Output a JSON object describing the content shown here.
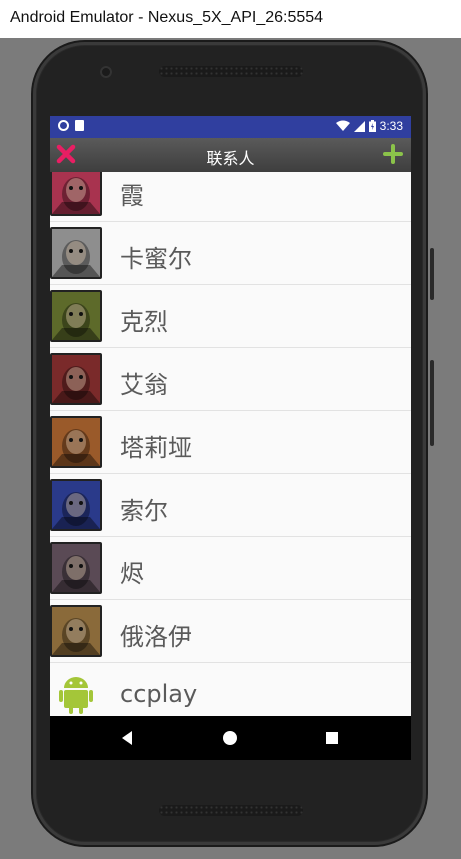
{
  "window": {
    "title": "Android Emulator - Nexus_5X_API_26:5554"
  },
  "statusbar": {
    "time": "3:33",
    "icons": [
      "sync-circle-icon",
      "sd-card-icon",
      "wifi-icon",
      "signal-icon",
      "battery-icon"
    ]
  },
  "toolbar": {
    "title": "联系人",
    "close_icon": "close-x-icon",
    "add_icon": "plus-icon"
  },
  "contacts": [
    {
      "name": "霞",
      "avatar": "champion-portrait-icon",
      "tone": "#a8334f"
    },
    {
      "name": "卡蜜尔",
      "avatar": "champion-portrait-icon",
      "tone": "#8e8e8e"
    },
    {
      "name": "克烈",
      "avatar": "champion-portrait-icon",
      "tone": "#5d6a2a"
    },
    {
      "name": "艾翁",
      "avatar": "champion-portrait-icon",
      "tone": "#7a2a2a"
    },
    {
      "name": "塔莉垭",
      "avatar": "champion-portrait-icon",
      "tone": "#9a5a2a"
    },
    {
      "name": "索尔",
      "avatar": "champion-portrait-icon",
      "tone": "#2a3a8a"
    },
    {
      "name": "烬",
      "avatar": "champion-portrait-icon",
      "tone": "#5a4a55"
    },
    {
      "name": "俄洛伊",
      "avatar": "champion-portrait-icon",
      "tone": "#8a6a3a"
    },
    {
      "name": "ccplay",
      "avatar": "android-robot-icon",
      "tone": "#a4c639"
    }
  ],
  "navbar": {
    "buttons": [
      "back-icon",
      "home-icon",
      "recents-icon"
    ]
  },
  "colors": {
    "statusbar": "#303f9f",
    "close": "#e91e63",
    "add": "#8bc34a",
    "android_green": "#a4c639"
  }
}
